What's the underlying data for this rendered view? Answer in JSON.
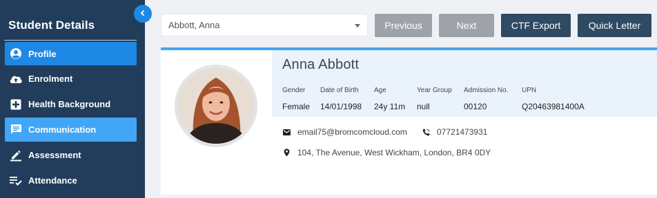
{
  "sidebar": {
    "title": "Student Details",
    "items": [
      {
        "label": "Profile",
        "icon": "account-circle-icon"
      },
      {
        "label": "Enrolment",
        "icon": "cloud-upload-icon"
      },
      {
        "label": "Health Background",
        "icon": "medical-plus-icon"
      },
      {
        "label": "Communication",
        "icon": "chat-icon"
      },
      {
        "label": "Assessment",
        "icon": "pencil-icon"
      },
      {
        "label": "Attendance",
        "icon": "checklist-icon"
      }
    ]
  },
  "toolbar": {
    "student_select": "Abbott, Anna",
    "previous_label": "Previous",
    "next_label": "Next",
    "ctf_export_label": "CTF Export",
    "quick_letter_label": "Quick Letter"
  },
  "student": {
    "name": "Anna Abbott",
    "fields": {
      "gender": {
        "label": "Gender",
        "value": "Female"
      },
      "dob": {
        "label": "Date of Birth",
        "value": "14/01/1998"
      },
      "age": {
        "label": "Age",
        "value": "24y 11m"
      },
      "year_group": {
        "label": "Year Group",
        "value": "null"
      },
      "admission_no": {
        "label": "Admission No.",
        "value": "00120"
      },
      "upn": {
        "label": "UPN",
        "value": "Q20463981400A"
      }
    },
    "email": "email75@bromcomcloud.com",
    "phone": "07721473931",
    "address": "104, The Avenue, West Wickham, London, BR4 0DY"
  },
  "colors": {
    "sidebar_bg": "#213d5b",
    "active_item": "#1e88e5",
    "hover_item": "#42a5f5",
    "dark_button": "#2f4a63",
    "disabled_button": "#9ea3a9"
  }
}
